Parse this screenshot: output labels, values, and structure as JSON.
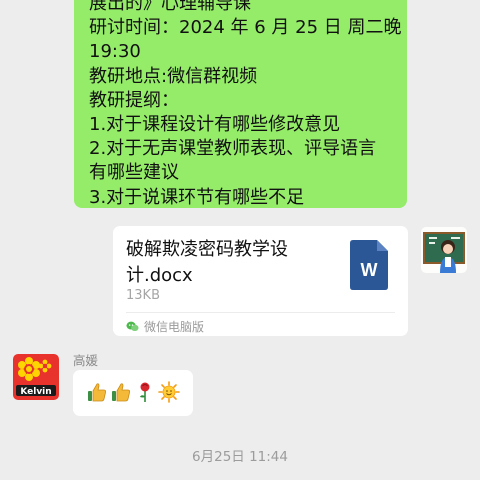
{
  "message_top": {
    "lines": [
      "展出的》心理辅导课",
      "研讨时间：2024 年 6 月 25 日 周二晚",
      "19:30",
      "教研地点:微信群视频",
      "教研提纲：",
      "1.对于课程设计有哪些修改意见",
      "2.对于无声课堂教师表现、评导语言",
      "有哪些建议",
      "3.对于说课环节有哪些不足"
    ]
  },
  "file_message": {
    "file_name": "破解欺凌密码教学设计.docx",
    "file_size": "13KB",
    "source": "微信电脑版",
    "icon": "word-doc-icon"
  },
  "reply": {
    "sender": "高媛",
    "emojis": [
      "thumbs-up-icon",
      "thumbs-up-icon",
      "rose-icon",
      "sun-icon"
    ]
  },
  "left_avatar": {
    "text": "Kelvin"
  },
  "timestamp": "6月25日 11:44",
  "colors": {
    "background": "#ededed",
    "bubble_outgoing": "#95ec69",
    "bubble_incoming": "#ffffff",
    "word_blue": "#2b5797"
  }
}
